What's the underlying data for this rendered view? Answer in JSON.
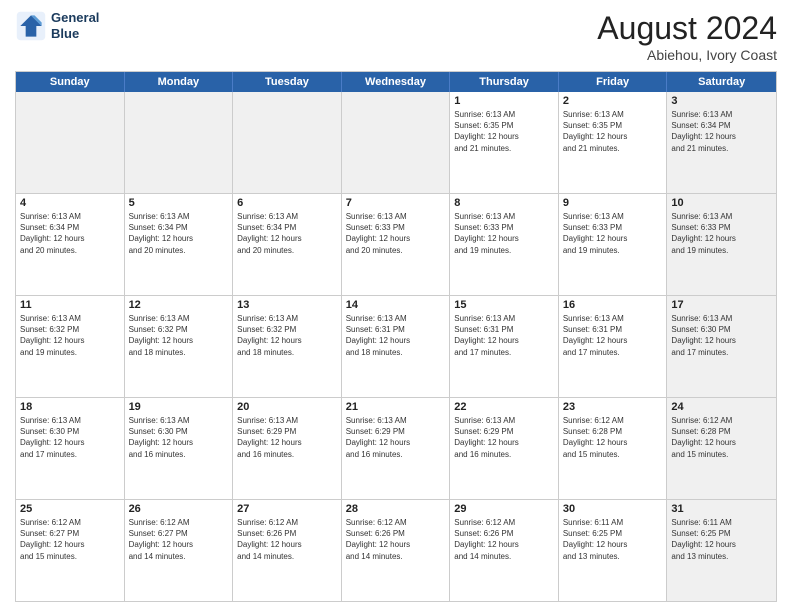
{
  "logo": {
    "line1": "General",
    "line2": "Blue"
  },
  "title": "August 2024",
  "location": "Abiehou, Ivory Coast",
  "days_of_week": [
    "Sunday",
    "Monday",
    "Tuesday",
    "Wednesday",
    "Thursday",
    "Friday",
    "Saturday"
  ],
  "weeks": [
    [
      {
        "day": "",
        "info": "",
        "shaded": true
      },
      {
        "day": "",
        "info": "",
        "shaded": true
      },
      {
        "day": "",
        "info": "",
        "shaded": true
      },
      {
        "day": "",
        "info": "",
        "shaded": true
      },
      {
        "day": "1",
        "info": "Sunrise: 6:13 AM\nSunset: 6:35 PM\nDaylight: 12 hours\nand 21 minutes.",
        "shaded": false
      },
      {
        "day": "2",
        "info": "Sunrise: 6:13 AM\nSunset: 6:35 PM\nDaylight: 12 hours\nand 21 minutes.",
        "shaded": false
      },
      {
        "day": "3",
        "info": "Sunrise: 6:13 AM\nSunset: 6:34 PM\nDaylight: 12 hours\nand 21 minutes.",
        "shaded": true
      }
    ],
    [
      {
        "day": "4",
        "info": "Sunrise: 6:13 AM\nSunset: 6:34 PM\nDaylight: 12 hours\nand 20 minutes.",
        "shaded": false
      },
      {
        "day": "5",
        "info": "Sunrise: 6:13 AM\nSunset: 6:34 PM\nDaylight: 12 hours\nand 20 minutes.",
        "shaded": false
      },
      {
        "day": "6",
        "info": "Sunrise: 6:13 AM\nSunset: 6:34 PM\nDaylight: 12 hours\nand 20 minutes.",
        "shaded": false
      },
      {
        "day": "7",
        "info": "Sunrise: 6:13 AM\nSunset: 6:33 PM\nDaylight: 12 hours\nand 20 minutes.",
        "shaded": false
      },
      {
        "day": "8",
        "info": "Sunrise: 6:13 AM\nSunset: 6:33 PM\nDaylight: 12 hours\nand 19 minutes.",
        "shaded": false
      },
      {
        "day": "9",
        "info": "Sunrise: 6:13 AM\nSunset: 6:33 PM\nDaylight: 12 hours\nand 19 minutes.",
        "shaded": false
      },
      {
        "day": "10",
        "info": "Sunrise: 6:13 AM\nSunset: 6:33 PM\nDaylight: 12 hours\nand 19 minutes.",
        "shaded": true
      }
    ],
    [
      {
        "day": "11",
        "info": "Sunrise: 6:13 AM\nSunset: 6:32 PM\nDaylight: 12 hours\nand 19 minutes.",
        "shaded": false
      },
      {
        "day": "12",
        "info": "Sunrise: 6:13 AM\nSunset: 6:32 PM\nDaylight: 12 hours\nand 18 minutes.",
        "shaded": false
      },
      {
        "day": "13",
        "info": "Sunrise: 6:13 AM\nSunset: 6:32 PM\nDaylight: 12 hours\nand 18 minutes.",
        "shaded": false
      },
      {
        "day": "14",
        "info": "Sunrise: 6:13 AM\nSunset: 6:31 PM\nDaylight: 12 hours\nand 18 minutes.",
        "shaded": false
      },
      {
        "day": "15",
        "info": "Sunrise: 6:13 AM\nSunset: 6:31 PM\nDaylight: 12 hours\nand 17 minutes.",
        "shaded": false
      },
      {
        "day": "16",
        "info": "Sunrise: 6:13 AM\nSunset: 6:31 PM\nDaylight: 12 hours\nand 17 minutes.",
        "shaded": false
      },
      {
        "day": "17",
        "info": "Sunrise: 6:13 AM\nSunset: 6:30 PM\nDaylight: 12 hours\nand 17 minutes.",
        "shaded": true
      }
    ],
    [
      {
        "day": "18",
        "info": "Sunrise: 6:13 AM\nSunset: 6:30 PM\nDaylight: 12 hours\nand 17 minutes.",
        "shaded": false
      },
      {
        "day": "19",
        "info": "Sunrise: 6:13 AM\nSunset: 6:30 PM\nDaylight: 12 hours\nand 16 minutes.",
        "shaded": false
      },
      {
        "day": "20",
        "info": "Sunrise: 6:13 AM\nSunset: 6:29 PM\nDaylight: 12 hours\nand 16 minutes.",
        "shaded": false
      },
      {
        "day": "21",
        "info": "Sunrise: 6:13 AM\nSunset: 6:29 PM\nDaylight: 12 hours\nand 16 minutes.",
        "shaded": false
      },
      {
        "day": "22",
        "info": "Sunrise: 6:13 AM\nSunset: 6:29 PM\nDaylight: 12 hours\nand 16 minutes.",
        "shaded": false
      },
      {
        "day": "23",
        "info": "Sunrise: 6:12 AM\nSunset: 6:28 PM\nDaylight: 12 hours\nand 15 minutes.",
        "shaded": false
      },
      {
        "day": "24",
        "info": "Sunrise: 6:12 AM\nSunset: 6:28 PM\nDaylight: 12 hours\nand 15 minutes.",
        "shaded": true
      }
    ],
    [
      {
        "day": "25",
        "info": "Sunrise: 6:12 AM\nSunset: 6:27 PM\nDaylight: 12 hours\nand 15 minutes.",
        "shaded": false
      },
      {
        "day": "26",
        "info": "Sunrise: 6:12 AM\nSunset: 6:27 PM\nDaylight: 12 hours\nand 14 minutes.",
        "shaded": false
      },
      {
        "day": "27",
        "info": "Sunrise: 6:12 AM\nSunset: 6:26 PM\nDaylight: 12 hours\nand 14 minutes.",
        "shaded": false
      },
      {
        "day": "28",
        "info": "Sunrise: 6:12 AM\nSunset: 6:26 PM\nDaylight: 12 hours\nand 14 minutes.",
        "shaded": false
      },
      {
        "day": "29",
        "info": "Sunrise: 6:12 AM\nSunset: 6:26 PM\nDaylight: 12 hours\nand 14 minutes.",
        "shaded": false
      },
      {
        "day": "30",
        "info": "Sunrise: 6:11 AM\nSunset: 6:25 PM\nDaylight: 12 hours\nand 13 minutes.",
        "shaded": false
      },
      {
        "day": "31",
        "info": "Sunrise: 6:11 AM\nSunset: 6:25 PM\nDaylight: 12 hours\nand 13 minutes.",
        "shaded": true
      }
    ]
  ]
}
